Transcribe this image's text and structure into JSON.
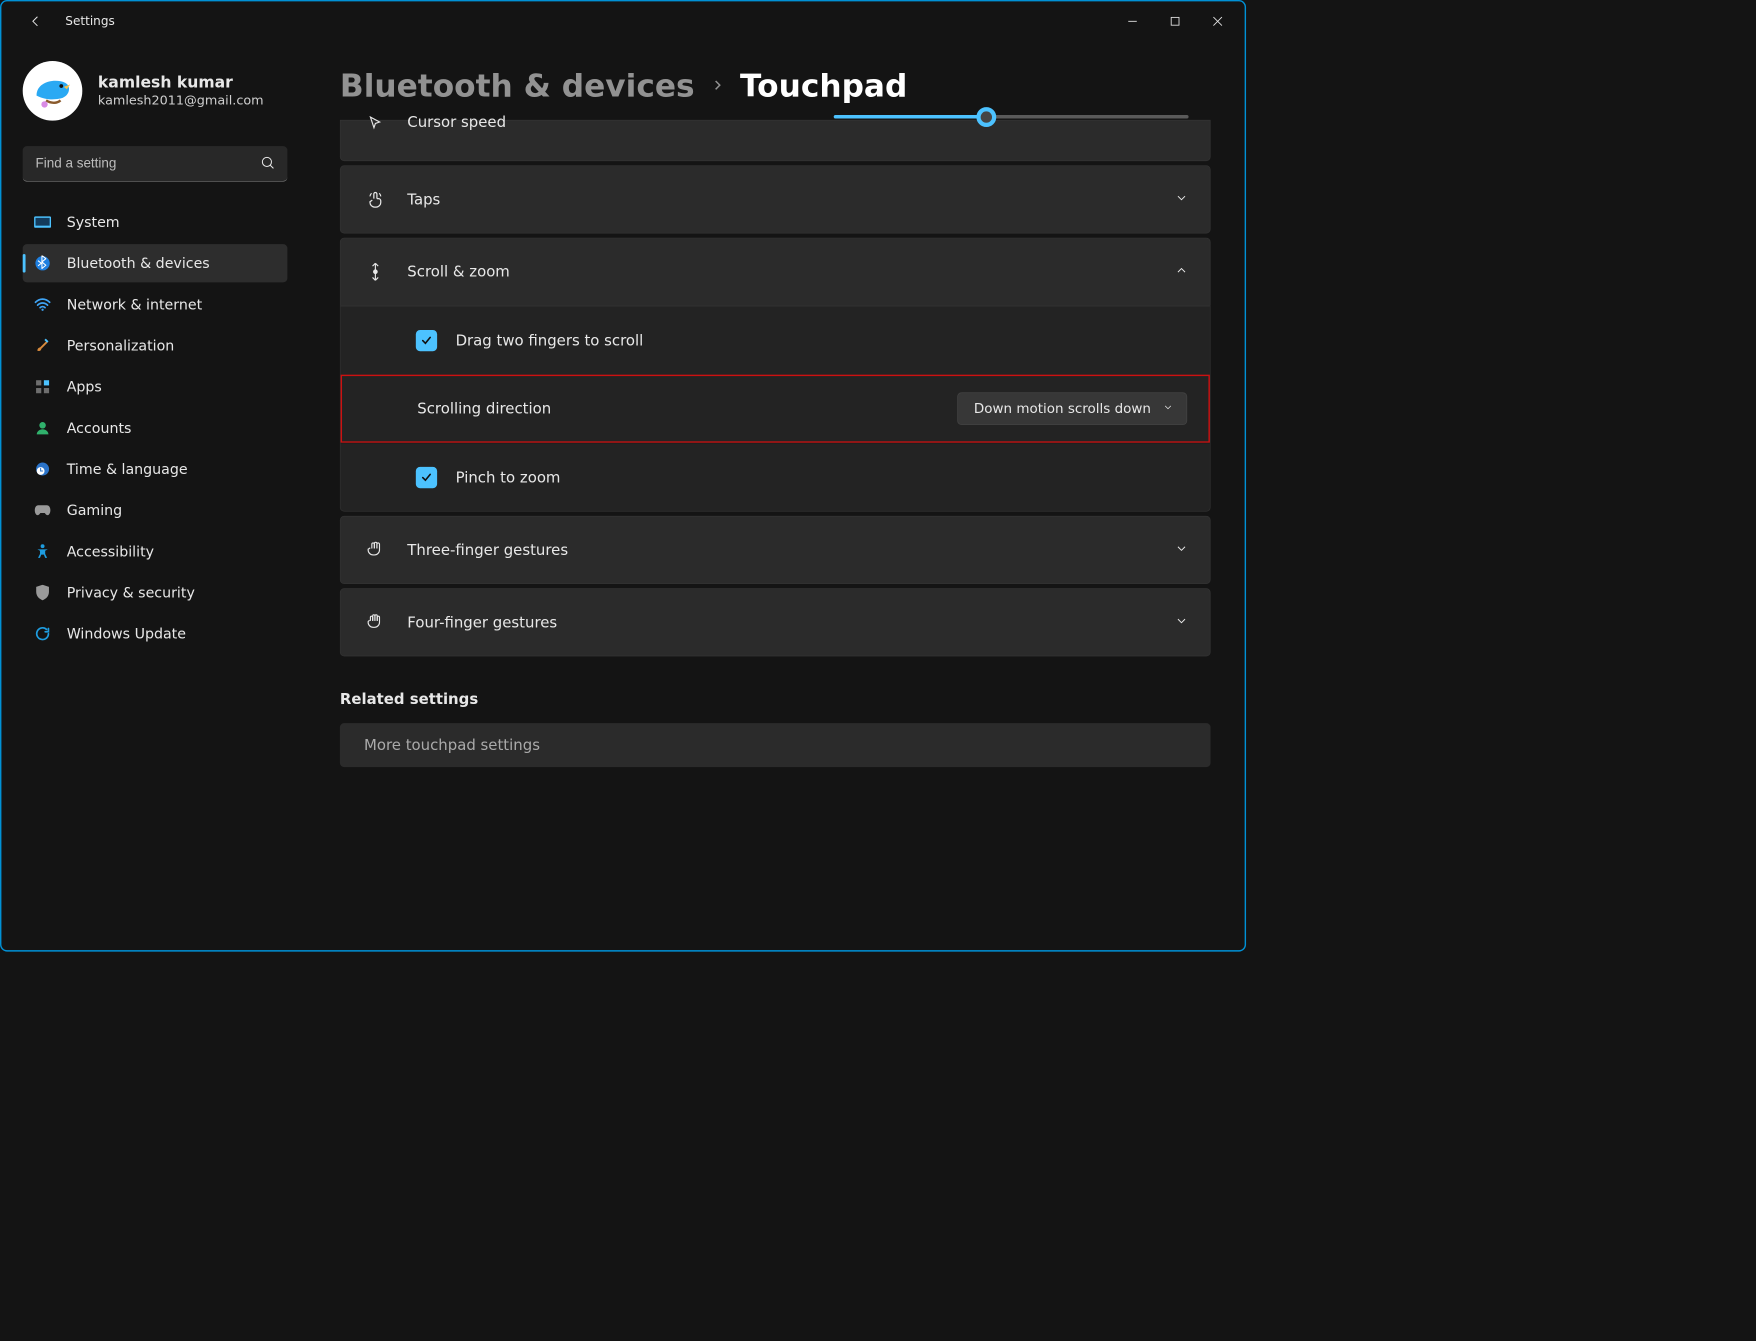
{
  "app_title": "Settings",
  "profile": {
    "name": "kamlesh kumar",
    "email": "kamlesh2011@gmail.com"
  },
  "search": {
    "placeholder": "Find a setting"
  },
  "nav": {
    "items": [
      {
        "label": "System"
      },
      {
        "label": "Bluetooth & devices"
      },
      {
        "label": "Network & internet"
      },
      {
        "label": "Personalization"
      },
      {
        "label": "Apps"
      },
      {
        "label": "Accounts"
      },
      {
        "label": "Time & language"
      },
      {
        "label": "Gaming"
      },
      {
        "label": "Accessibility"
      },
      {
        "label": "Privacy & security"
      },
      {
        "label": "Windows Update"
      }
    ],
    "selected_index": 1
  },
  "breadcrumb": {
    "parent": "Bluetooth & devices",
    "current": "Touchpad"
  },
  "cards": {
    "cursor_speed": {
      "label": "Cursor speed"
    },
    "taps": {
      "label": "Taps"
    },
    "scroll_zoom": {
      "label": "Scroll & zoom",
      "drag_two_fingers": "Drag two fingers to scroll",
      "scrolling_direction_label": "Scrolling direction",
      "scrolling_direction_value": "Down motion scrolls down",
      "pinch_to_zoom": "Pinch to zoom"
    },
    "three_finger": {
      "label": "Three-finger gestures"
    },
    "four_finger": {
      "label": "Four-finger gestures"
    }
  },
  "related": {
    "heading": "Related settings",
    "more": "More touchpad settings"
  }
}
